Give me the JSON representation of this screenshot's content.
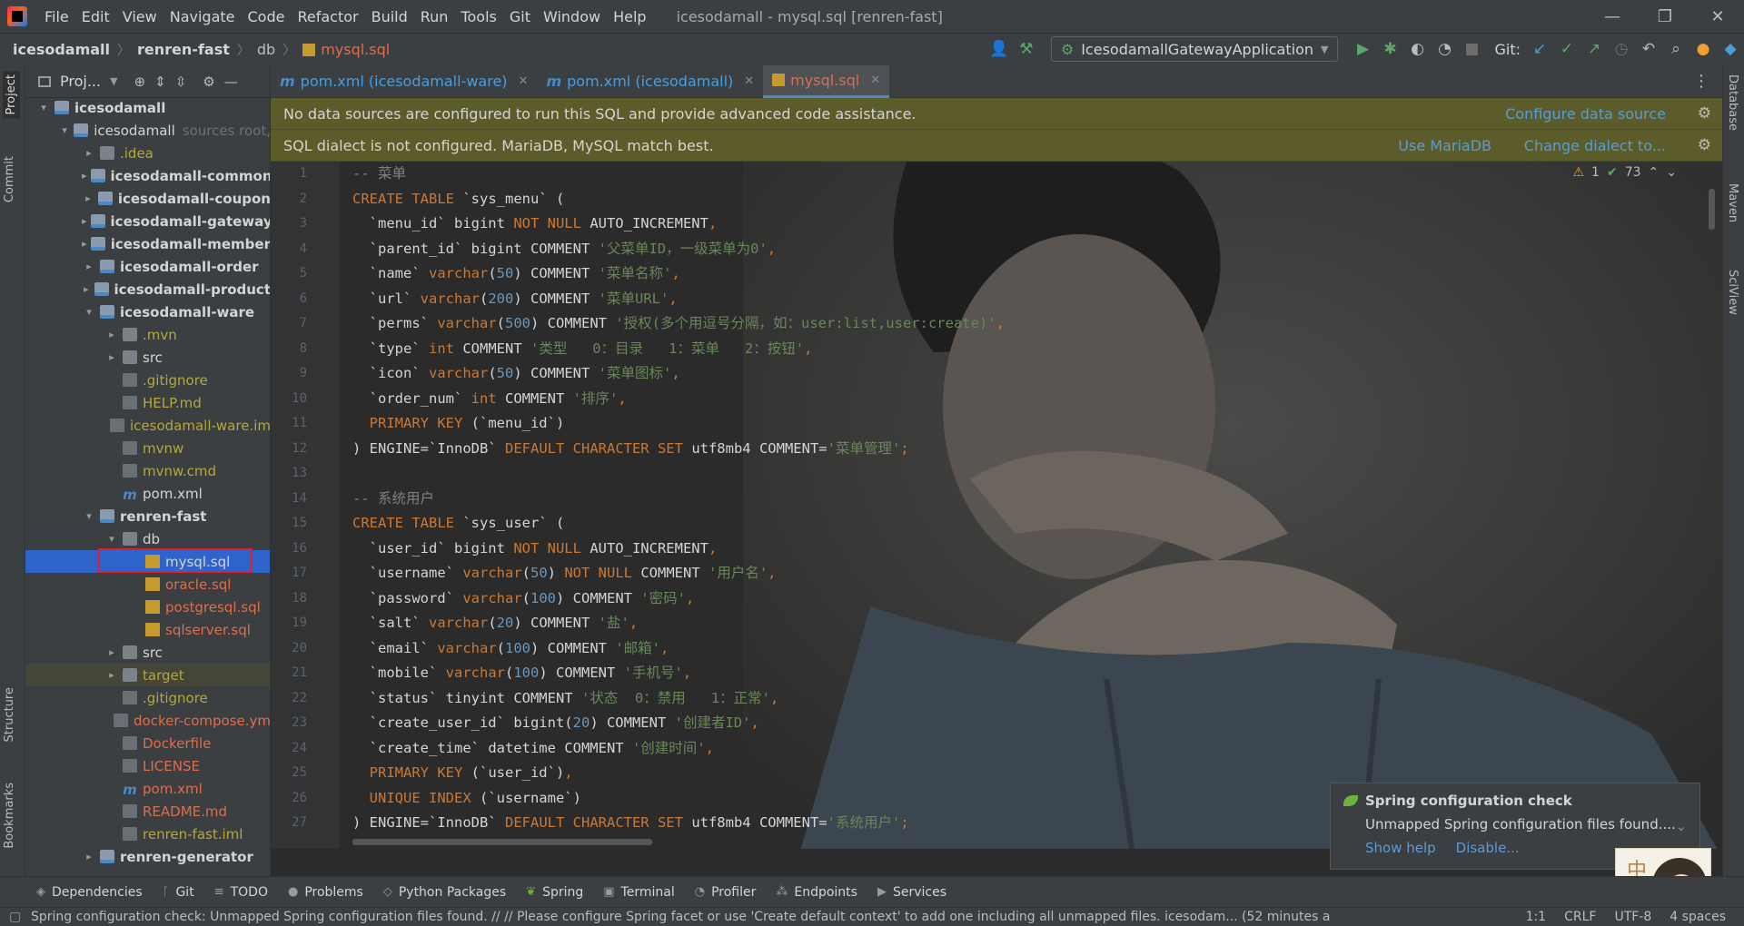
{
  "window": {
    "title": "icesodamall - mysql.sql [renren-fast]"
  },
  "menu": [
    "File",
    "Edit",
    "View",
    "Navigate",
    "Code",
    "Refactor",
    "Build",
    "Run",
    "Tools",
    "Git",
    "Window",
    "Help"
  ],
  "breadcrumb": {
    "root": "icesodamall",
    "module": "renren-fast",
    "folder": "db",
    "file": "mysql.sql"
  },
  "toolbar": {
    "run_config": "IcesodamallGatewayApplication",
    "git_label": "Git:"
  },
  "left_strip": {
    "project": "Project",
    "commit": "Commit",
    "structure": "Structure",
    "bookmarks": "Bookmarks"
  },
  "right_strip": {
    "database": "Database",
    "maven": "Maven",
    "sciview": "SciView"
  },
  "project_panel": {
    "title": "Proj...",
    "tree": [
      {
        "label": "icesodamall",
        "indent": 0,
        "arrow": "open",
        "icon": "module",
        "style": "bold"
      },
      {
        "label": "icesodamall",
        "hint": "sources root,",
        "indent": 1,
        "arrow": "open",
        "icon": "module",
        "style": "plain"
      },
      {
        "label": ".idea",
        "indent": 2,
        "arrow": "closed",
        "icon": "folder",
        "style": "yellow"
      },
      {
        "label": "icesodamall-common",
        "indent": 2,
        "arrow": "closed",
        "icon": "module",
        "style": "bold"
      },
      {
        "label": "icesodamall-coupon",
        "indent": 2,
        "arrow": "closed",
        "icon": "module",
        "style": "bold"
      },
      {
        "label": "icesodamall-gateway",
        "indent": 2,
        "arrow": "closed",
        "icon": "module",
        "style": "bold"
      },
      {
        "label": "icesodamall-member",
        "indent": 2,
        "arrow": "closed",
        "icon": "module",
        "style": "bold"
      },
      {
        "label": "icesodamall-order",
        "indent": 2,
        "arrow": "closed",
        "icon": "module",
        "style": "bold"
      },
      {
        "label": "icesodamall-product",
        "indent": 2,
        "arrow": "closed",
        "icon": "module",
        "style": "bold"
      },
      {
        "label": "icesodamall-ware",
        "indent": 2,
        "arrow": "open",
        "icon": "module",
        "style": "bold"
      },
      {
        "label": ".mvn",
        "indent": 3,
        "arrow": "closed",
        "icon": "folder",
        "style": "yellow"
      },
      {
        "label": "src",
        "indent": 3,
        "arrow": "closed",
        "icon": "folder",
        "style": "plain"
      },
      {
        "label": ".gitignore",
        "indent": 3,
        "arrow": "none",
        "icon": "file",
        "style": "yellow"
      },
      {
        "label": "HELP.md",
        "indent": 3,
        "arrow": "none",
        "icon": "file",
        "style": "yellow"
      },
      {
        "label": "icesodamall-ware.im",
        "indent": 3,
        "arrow": "none",
        "icon": "file",
        "style": "yellow"
      },
      {
        "label": "mvnw",
        "indent": 3,
        "arrow": "none",
        "icon": "file",
        "style": "yellow"
      },
      {
        "label": "mvnw.cmd",
        "indent": 3,
        "arrow": "none",
        "icon": "file",
        "style": "yellow"
      },
      {
        "label": "pom.xml",
        "indent": 3,
        "arrow": "none",
        "icon": "maven",
        "style": "plain"
      },
      {
        "label": "renren-fast",
        "indent": 2,
        "arrow": "open",
        "icon": "module",
        "style": "bold"
      },
      {
        "label": "db",
        "indent": 3,
        "arrow": "open",
        "icon": "folder",
        "style": "plain"
      },
      {
        "label": "mysql.sql",
        "indent": 4,
        "arrow": "none",
        "icon": "sql",
        "style": "plain",
        "selected": true
      },
      {
        "label": "oracle.sql",
        "indent": 4,
        "arrow": "none",
        "icon": "sql",
        "style": "red"
      },
      {
        "label": "postgresql.sql",
        "indent": 4,
        "arrow": "none",
        "icon": "sql",
        "style": "red"
      },
      {
        "label": "sqlserver.sql",
        "indent": 4,
        "arrow": "none",
        "icon": "sql",
        "style": "red"
      },
      {
        "label": "src",
        "indent": 3,
        "arrow": "closed",
        "icon": "folder",
        "style": "plain"
      },
      {
        "label": "target",
        "indent": 3,
        "arrow": "closed",
        "icon": "folder",
        "style": "yellow",
        "highlight": true
      },
      {
        "label": ".gitignore",
        "indent": 3,
        "arrow": "none",
        "icon": "file",
        "style": "yellow"
      },
      {
        "label": "docker-compose.ym",
        "indent": 3,
        "arrow": "none",
        "icon": "file",
        "style": "red"
      },
      {
        "label": "Dockerfile",
        "indent": 3,
        "arrow": "none",
        "icon": "file",
        "style": "red"
      },
      {
        "label": "LICENSE",
        "indent": 3,
        "arrow": "none",
        "icon": "file",
        "style": "red"
      },
      {
        "label": "pom.xml",
        "indent": 3,
        "arrow": "none",
        "icon": "maven",
        "style": "red"
      },
      {
        "label": "README.md",
        "indent": 3,
        "arrow": "none",
        "icon": "file",
        "style": "red"
      },
      {
        "label": "renren-fast.iml",
        "indent": 3,
        "arrow": "none",
        "icon": "file",
        "style": "yellow"
      },
      {
        "label": "renren-generator",
        "indent": 2,
        "arrow": "closed",
        "icon": "module",
        "style": "bold"
      }
    ]
  },
  "tabs": [
    {
      "label": "pom.xml (icesodamall-ware)",
      "icon": "m",
      "active": false
    },
    {
      "label": "pom.xml (icesodamall)",
      "icon": "m",
      "active": false
    },
    {
      "label": "mysql.sql",
      "icon": "sql",
      "active": true
    }
  ],
  "banners": {
    "datasource": {
      "text": "No data sources are configured to run this SQL and provide advanced code assistance.",
      "link": "Configure data source"
    },
    "dialect": {
      "text": "SQL dialect is not configured. MariaDB, MySQL match best.",
      "link1": "Use MariaDB",
      "link2": "Change dialect to..."
    }
  },
  "inspection": {
    "warnings": "1",
    "checks": "73"
  },
  "code_lines": [
    [
      [
        "cm",
        "-- 菜单"
      ]
    ],
    [
      [
        "kw",
        "CREATE TABLE "
      ],
      [
        "id",
        "`sys_menu`"
      ],
      [
        "id",
        " ("
      ]
    ],
    [
      [
        "id",
        "  `menu_id` "
      ],
      [
        "id",
        "bigint "
      ],
      [
        "kw",
        "NOT NULL "
      ],
      [
        "id",
        "AUTO_INCREMENT"
      ],
      [
        "kw",
        ","
      ]
    ],
    [
      [
        "id",
        "  `parent_id` bigint COMMENT "
      ],
      [
        "str",
        "'父菜单ID，一级菜单为0'"
      ],
      [
        "kw",
        ","
      ]
    ],
    [
      [
        "id",
        "  `name` "
      ],
      [
        "kw",
        "varchar"
      ],
      [
        "id",
        "("
      ],
      [
        "num",
        "50"
      ],
      [
        "id",
        ") COMMENT "
      ],
      [
        "str",
        "'菜单名称'"
      ],
      [
        "kw",
        ","
      ]
    ],
    [
      [
        "id",
        "  `url` "
      ],
      [
        "kw",
        "varchar"
      ],
      [
        "id",
        "("
      ],
      [
        "num",
        "200"
      ],
      [
        "id",
        ") COMMENT "
      ],
      [
        "str",
        "'菜单URL'"
      ],
      [
        "kw",
        ","
      ]
    ],
    [
      [
        "id",
        "  `perms` "
      ],
      [
        "kw",
        "varchar"
      ],
      [
        "id",
        "("
      ],
      [
        "num",
        "500"
      ],
      [
        "id",
        ") COMMENT "
      ],
      [
        "str",
        "'授权(多个用逗号分隔，如：user:list,user:create)'"
      ],
      [
        "kw",
        ","
      ]
    ],
    [
      [
        "id",
        "  `type` "
      ],
      [
        "kw",
        "int "
      ],
      [
        "id",
        "COMMENT "
      ],
      [
        "str",
        "'类型   0：目录   1：菜单   2：按钮'"
      ],
      [
        "kw",
        ","
      ]
    ],
    [
      [
        "id",
        "  `icon` "
      ],
      [
        "kw",
        "varchar"
      ],
      [
        "id",
        "("
      ],
      [
        "num",
        "50"
      ],
      [
        "id",
        ") COMMENT "
      ],
      [
        "str",
        "'菜单图标'"
      ],
      [
        "kw",
        ","
      ]
    ],
    [
      [
        "id",
        "  `order_num` "
      ],
      [
        "kw",
        "int "
      ],
      [
        "id",
        "COMMENT "
      ],
      [
        "str",
        "'排序'"
      ],
      [
        "kw",
        ","
      ]
    ],
    [
      [
        "kw",
        "  PRIMARY KEY "
      ],
      [
        "id",
        "(`menu_id`)"
      ]
    ],
    [
      [
        "id",
        ") ENGINE="
      ],
      [
        "id",
        "`InnoDB` "
      ],
      [
        "kw",
        "DEFAULT CHARACTER SET "
      ],
      [
        "id",
        "utf8mb4 COMMENT="
      ],
      [
        "str",
        "'菜单管理'"
      ],
      [
        "kw",
        ";"
      ]
    ],
    [],
    [
      [
        "cm",
        "-- 系统用户"
      ]
    ],
    [
      [
        "kw",
        "CREATE TABLE "
      ],
      [
        "id",
        "`sys_user`"
      ],
      [
        "id",
        " ("
      ]
    ],
    [
      [
        "id",
        "  `user_id` "
      ],
      [
        "id",
        "bigint "
      ],
      [
        "kw",
        "NOT NULL "
      ],
      [
        "id",
        "AUTO_INCREMENT"
      ],
      [
        "kw",
        ","
      ]
    ],
    [
      [
        "id",
        "  `username` "
      ],
      [
        "kw",
        "varchar"
      ],
      [
        "id",
        "("
      ],
      [
        "num",
        "50"
      ],
      [
        "id",
        ") "
      ],
      [
        "kw",
        "NOT NULL "
      ],
      [
        "id",
        "COMMENT "
      ],
      [
        "str",
        "'用户名'"
      ],
      [
        "kw",
        ","
      ]
    ],
    [
      [
        "id",
        "  `password` "
      ],
      [
        "kw",
        "varchar"
      ],
      [
        "id",
        "("
      ],
      [
        "num",
        "100"
      ],
      [
        "id",
        ") COMMENT "
      ],
      [
        "str",
        "'密码'"
      ],
      [
        "kw",
        ","
      ]
    ],
    [
      [
        "id",
        "  `salt` "
      ],
      [
        "kw",
        "varchar"
      ],
      [
        "id",
        "("
      ],
      [
        "num",
        "20"
      ],
      [
        "id",
        ") COMMENT "
      ],
      [
        "str",
        "'盐'"
      ],
      [
        "kw",
        ","
      ]
    ],
    [
      [
        "id",
        "  `email` "
      ],
      [
        "kw",
        "varchar"
      ],
      [
        "id",
        "("
      ],
      [
        "num",
        "100"
      ],
      [
        "id",
        ") COMMENT "
      ],
      [
        "str",
        "'邮箱'"
      ],
      [
        "kw",
        ","
      ]
    ],
    [
      [
        "id",
        "  `mobile` "
      ],
      [
        "kw",
        "varchar"
      ],
      [
        "id",
        "("
      ],
      [
        "num",
        "100"
      ],
      [
        "id",
        ") COMMENT "
      ],
      [
        "str",
        "'手机号'"
      ],
      [
        "kw",
        ","
      ]
    ],
    [
      [
        "id",
        "  `status` "
      ],
      [
        "id",
        "tinyint "
      ],
      [
        "id",
        "COMMENT "
      ],
      [
        "str",
        "'状态  0：禁用   1：正常'"
      ],
      [
        "kw",
        ","
      ]
    ],
    [
      [
        "id",
        "  `create_user_id` "
      ],
      [
        "id",
        "bigint("
      ],
      [
        "num",
        "20"
      ],
      [
        "id",
        ") COMMENT "
      ],
      [
        "str",
        "'创建者ID'"
      ],
      [
        "kw",
        ","
      ]
    ],
    [
      [
        "id",
        "  `create_time` "
      ],
      [
        "id",
        "datetime COMMENT "
      ],
      [
        "str",
        "'创建时间'"
      ],
      [
        "kw",
        ","
      ]
    ],
    [
      [
        "kw",
        "  PRIMARY KEY "
      ],
      [
        "id",
        "(`user_id`)"
      ],
      [
        "kw",
        ","
      ]
    ],
    [
      [
        "kw",
        "  UNIQUE INDEX "
      ],
      [
        "id",
        "(`username`)"
      ]
    ],
    [
      [
        "id",
        ") ENGINE="
      ],
      [
        "id",
        "`InnoDB` "
      ],
      [
        "kw",
        "DEFAULT CHARACTER SET "
      ],
      [
        "id",
        "utf8mb4 COMMENT="
      ],
      [
        "str",
        "'系统用户'"
      ],
      [
        "kw",
        ";"
      ]
    ]
  ],
  "notification": {
    "title": "Spring configuration check",
    "message": "Unmapped Spring configuration files found....",
    "link1": "Show help",
    "link2": "Disable..."
  },
  "avatar_glyph": "中",
  "bottom_tools": [
    "Dependencies",
    "Git",
    "TODO",
    "Problems",
    "Python Packages",
    "Spring",
    "Terminal",
    "Profiler",
    "Endpoints",
    "Services"
  ],
  "status": {
    "message": "Spring configuration check: Unmapped Spring configuration files found. // // Please configure Spring facet or use 'Create default context' to add one including all unmapped files. icesodam... (52 minutes a",
    "position": "1:1",
    "line_sep": "CRLF",
    "encoding": "UTF-8",
    "indent": "4 spaces"
  }
}
